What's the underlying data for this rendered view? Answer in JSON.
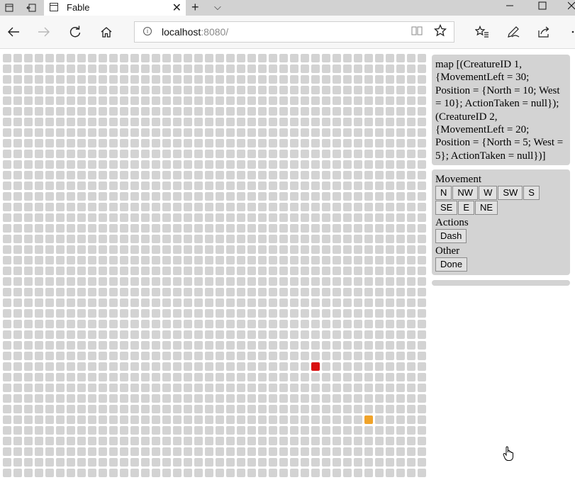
{
  "tab": {
    "title": "Fable",
    "close_icon": "✕"
  },
  "tabstrip": {
    "new_tab_icon": "+",
    "chevron_icon": "⌵"
  },
  "address": {
    "host": "localhost",
    "port_path": ":8080/"
  },
  "grid": {
    "columns": 40,
    "rows": 40,
    "red_cell": {
      "col": 29,
      "row": 29
    },
    "orange_cell": {
      "col": 34,
      "row": 34
    },
    "colors": {
      "empty": "#d3d3d3",
      "red": "#d80f0f",
      "orange": "#f0a329"
    }
  },
  "state_text": "map [(CreatureID 1, {MovementLeft = 30; Position = {North = 10; West = 10}; ActionTaken = null}); (CreatureID 2, {MovementLeft = 20; Position = {North = 5; West = 5}; ActionTaken = null})]",
  "controls": {
    "movement_label": "Movement",
    "movement_buttons": [
      "N",
      "NW",
      "W",
      "SW",
      "S",
      "SE",
      "E",
      "NE"
    ],
    "actions_label": "Actions",
    "dash_label": "Dash",
    "other_label": "Other",
    "done_label": "Done"
  }
}
